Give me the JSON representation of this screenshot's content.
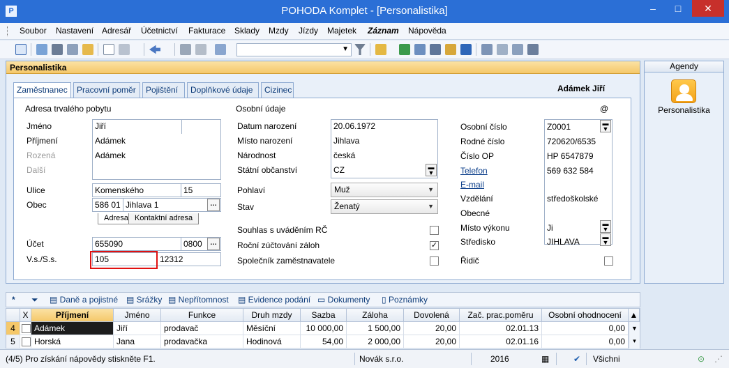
{
  "window": {
    "title": "POHODA Komplet - [Personalistika]",
    "app_icon": "pohoda-icon",
    "minimize": "–",
    "maximize": "□",
    "close": "✕"
  },
  "menu": [
    "Soubor",
    "Nastavení",
    "Adresář",
    "Účetnictví",
    "Fakturace",
    "Sklady",
    "Mzdy",
    "Jízdy",
    "Majetek",
    "Záznam",
    "Nápověda"
  ],
  "panel": {
    "title": "Personalistika",
    "employee_name": "Adámek Jiří"
  },
  "tabs": [
    "Zaměstnanec",
    "Pracovní poměr",
    "Pojištění",
    "Doplňkové údaje",
    "Cizinec"
  ],
  "address": {
    "section": "Adresa trvalého pobytu",
    "jmeno_label": "Jméno",
    "jmeno": "Jiří",
    "prijmeni_label": "Příjmení",
    "prijmeni": "Adámek",
    "rozena_label": "Rozená",
    "rozena": "Adámek",
    "dalsi_label": "Další",
    "ulice_label": "Ulice",
    "ulice": "Komenského",
    "cislo": "15",
    "obec_label": "Obec",
    "psc": "586 01",
    "obec": "Jihlava 1",
    "subtab_adresa": "Adresa",
    "subtab_kontaktni": "Kontaktní adresa",
    "ucet_label": "Účet",
    "ucet": "655090",
    "kod_banky": "0800",
    "vs_label": "V.s./S.s.",
    "vs": "105",
    "ss": "12312"
  },
  "personal": {
    "section": "Osobní údaje",
    "datum_label": "Datum narození",
    "datum": "20.06.1972",
    "misto_label": "Místo narození",
    "misto": "Jihlava",
    "narodnost_label": "Národnost",
    "narodnost": "česká",
    "obcanstvi_label": "Státní občanství",
    "obcanstvi": "CZ",
    "pohlavi_label": "Pohlaví",
    "pohlavi": "Muž",
    "stav_label": "Stav",
    "stav": "Ženatý",
    "souhlas_label": "Souhlas s uváděním RČ",
    "rocni_label": "Roční zúčtování záloh",
    "spolecnik_label": "Společník zaměstnavatele"
  },
  "ids": {
    "at": "@",
    "osobni_cislo_label": "Osobní číslo",
    "osobni_cislo": "Z0001",
    "rodne_cislo_label": "Rodné číslo",
    "rodne_cislo": "720620/6535",
    "cislo_op_label": "Číslo OP",
    "cislo_op": "HP 6547879",
    "telefon_label": "Telefon",
    "telefon": "569 632 584",
    "email_label": "E-mail",
    "vzdelani_label": "Vzdělání",
    "vzdelani": "středoškolské",
    "obecne_label": "Obecné",
    "misto_vykonu_label": "Místo výkonu",
    "misto_vykonu": "Ji",
    "stredisko_label": "Středisko",
    "stredisko": "JIHLAVA",
    "ridic_label": "Řidič"
  },
  "checks": {
    "souhlas": false,
    "rocni": true,
    "spolecnik": false,
    "ridic": false
  },
  "side": {
    "title": "Agendy",
    "item": "Personalistika"
  },
  "grid_tabs": [
    "*",
    "Daně a pojistné",
    "Srážky",
    "Nepřítomnost",
    "Evidence podání",
    "Dokumenty",
    "Poznámky"
  ],
  "grid": {
    "headers": [
      "X",
      "Příjmení",
      "Jméno",
      "Funkce",
      "Druh mzdy",
      "Sazba",
      "Záloha",
      "Dovolená",
      "Zač. prac.poměru",
      "Osobní ohodnocení"
    ],
    "rows": [
      {
        "n": "4",
        "prijmeni": "Adámek",
        "jmeno": "Jiří",
        "funkce": "prodavač",
        "druh": "Měsíční",
        "sazba": "10 000,00",
        "zaloha": "1 500,00",
        "dovolena": "20,00",
        "zacatek": "02.01.13",
        "ohodnoceni": "0,00"
      },
      {
        "n": "5",
        "prijmeni": "Horská",
        "jmeno": "Jana",
        "funkce": "prodavačka",
        "druh": "Hodinová",
        "sazba": "54,00",
        "zaloha": "2 000,00",
        "dovolena": "20,00",
        "zacatek": "02.01.16",
        "ohodnoceni": "0,00"
      }
    ]
  },
  "status": {
    "hint": "(4/5) Pro získání nápovědy stiskněte F1.",
    "company": "Novák s.r.o.",
    "year": "2016",
    "user": "Všichni"
  }
}
